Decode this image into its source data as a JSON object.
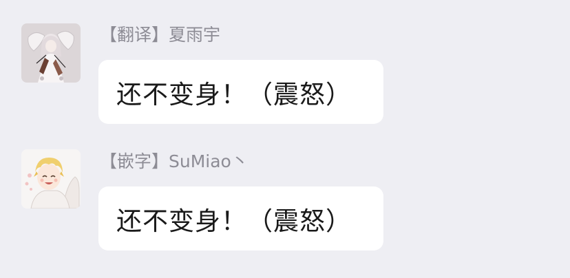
{
  "messages": [
    {
      "sender": "【翻译】夏雨宇",
      "text": "还不变身！（震怒）",
      "avatar_icon": "anime-girl-with-wings-avatar"
    },
    {
      "sender": "【嵌字】SuMiao丶",
      "text": "还不变身！（震怒）",
      "avatar_icon": "smiling-blond-boy-avatar"
    }
  ],
  "colors": {
    "background": "#eeeef3",
    "bubble": "#ffffff",
    "sender_text": "#8d8c95",
    "message_text": "#1a1a1a"
  }
}
